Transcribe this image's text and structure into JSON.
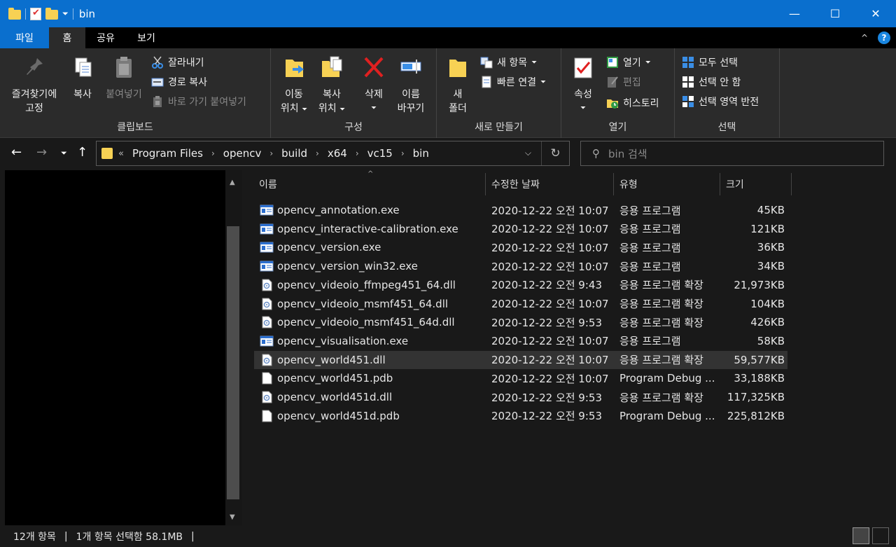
{
  "window": {
    "title": "bin"
  },
  "tabs": [
    {
      "label": "파일"
    },
    {
      "label": "홈"
    },
    {
      "label": "공유"
    },
    {
      "label": "보기"
    }
  ],
  "ribbon": {
    "clipboard": {
      "label": "클립보드",
      "pin_label_1": "즐겨찾기에",
      "pin_label_2": "고정",
      "copy": "복사",
      "paste": "붙여넣기",
      "cut": "잘라내기",
      "copy_path": "경로 복사",
      "paste_shortcut": "바로 가기 붙여넣기"
    },
    "organize": {
      "label": "구성",
      "move_1": "이동",
      "move_2": "위치",
      "copyto_1": "복사",
      "copyto_2": "위치",
      "delete": "삭제",
      "rename_1": "이름",
      "rename_2": "바꾸기"
    },
    "new": {
      "label": "새로 만들기",
      "folder_1": "새",
      "folder_2": "폴더",
      "new_item": "새 항목",
      "easy_access": "빠른 연결"
    },
    "open": {
      "label": "열기",
      "properties": "속성",
      "open": "열기",
      "edit": "편집",
      "history": "히스토리"
    },
    "select": {
      "label": "선택",
      "select_all": "모두 선택",
      "select_none": "선택 안 함",
      "invert": "선택 영역 반전"
    }
  },
  "address": {
    "crumbs": [
      "Program Files",
      "opencv",
      "build",
      "x64",
      "vc15",
      "bin"
    ],
    "search_placeholder": "bin 검색"
  },
  "columns": {
    "name": "이름",
    "date": "수정한 날짜",
    "type": "유형",
    "size": "크기"
  },
  "files": [
    {
      "name": "opencv_annotation.exe",
      "date": "2020-12-22 오전 10:07",
      "type": "응용 프로그램",
      "size": "45KB",
      "icon": "exe-icon"
    },
    {
      "name": "opencv_interactive-calibration.exe",
      "date": "2020-12-22 오전 10:07",
      "type": "응용 프로그램",
      "size": "121KB",
      "icon": "exe-icon"
    },
    {
      "name": "opencv_version.exe",
      "date": "2020-12-22 오전 10:07",
      "type": "응용 프로그램",
      "size": "36KB",
      "icon": "exe-icon"
    },
    {
      "name": "opencv_version_win32.exe",
      "date": "2020-12-22 오전 10:07",
      "type": "응용 프로그램",
      "size": "34KB",
      "icon": "exe-icon"
    },
    {
      "name": "opencv_videoio_ffmpeg451_64.dll",
      "date": "2020-12-22 오전 9:43",
      "type": "응용 프로그램 확장",
      "size": "21,973KB",
      "icon": "dll-icon"
    },
    {
      "name": "opencv_videoio_msmf451_64.dll",
      "date": "2020-12-22 오전 10:07",
      "type": "응용 프로그램 확장",
      "size": "104KB",
      "icon": "dll-icon"
    },
    {
      "name": "opencv_videoio_msmf451_64d.dll",
      "date": "2020-12-22 오전 9:53",
      "type": "응용 프로그램 확장",
      "size": "426KB",
      "icon": "dll-icon"
    },
    {
      "name": "opencv_visualisation.exe",
      "date": "2020-12-22 오전 10:07",
      "type": "응용 프로그램",
      "size": "58KB",
      "icon": "exe-icon"
    },
    {
      "name": "opencv_world451.dll",
      "date": "2020-12-22 오전 10:07",
      "type": "응용 프로그램 확장",
      "size": "59,577KB",
      "icon": "dll-icon",
      "selected": true
    },
    {
      "name": "opencv_world451.pdb",
      "date": "2020-12-22 오전 10:07",
      "type": "Program Debug ...",
      "size": "33,188KB",
      "icon": "file-icon"
    },
    {
      "name": "opencv_world451d.dll",
      "date": "2020-12-22 오전 9:53",
      "type": "응용 프로그램 확장",
      "size": "117,325KB",
      "icon": "dll-icon"
    },
    {
      "name": "opencv_world451d.pdb",
      "date": "2020-12-22 오전 9:53",
      "type": "Program Debug ...",
      "size": "225,812KB",
      "icon": "file-icon"
    }
  ],
  "status": {
    "count": "12개 항목",
    "selection": "1개 항목 선택함 58.1MB"
  },
  "colors": {
    "titlebar": "#0a6fce",
    "ribbon": "#2b2b2b",
    "background": "#191919",
    "selected_row": "#333333"
  }
}
